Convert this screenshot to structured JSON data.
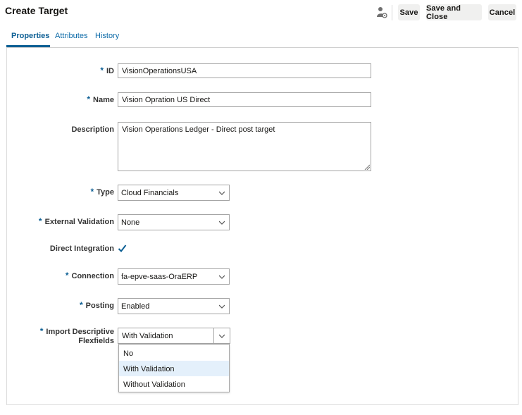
{
  "header": {
    "title": "Create Target",
    "icon": "user-settings-icon",
    "save_label": "Save",
    "save_close_label": "Save and Close",
    "cancel_label": "Cancel"
  },
  "tabs": [
    {
      "label": "Properties",
      "active": true
    },
    {
      "label": "Attributes",
      "active": false
    },
    {
      "label": "History",
      "active": false
    }
  ],
  "form": {
    "required_mark": "*",
    "id": {
      "label": "ID",
      "value": "VisionOperationsUSA"
    },
    "name": {
      "label": "Name",
      "value": "Vision Opration US Direct"
    },
    "description": {
      "label": "Description",
      "value": "Vision Operations Ledger - Direct post target"
    },
    "type": {
      "label": "Type",
      "value": "Cloud Financials"
    },
    "external_validation": {
      "label": "External Validation",
      "value": "None"
    },
    "direct_integration": {
      "label": "Direct Integration",
      "checked": true
    },
    "connection": {
      "label": "Connection",
      "value": "fa-epve-saas-OraERP"
    },
    "posting": {
      "label": "Posting",
      "value": "Enabled"
    },
    "import_flexfields": {
      "label_line1": "Import Descriptive",
      "label_line2": "Flexfields",
      "value": "With Validation",
      "options": [
        "No",
        "With Validation",
        "Without Validation"
      ],
      "highlighted_option": "With Validation"
    }
  },
  "colors": {
    "accent": "#0d5f94",
    "highlight": "#e4f0fb",
    "button_bg": "#f0f0ef"
  }
}
